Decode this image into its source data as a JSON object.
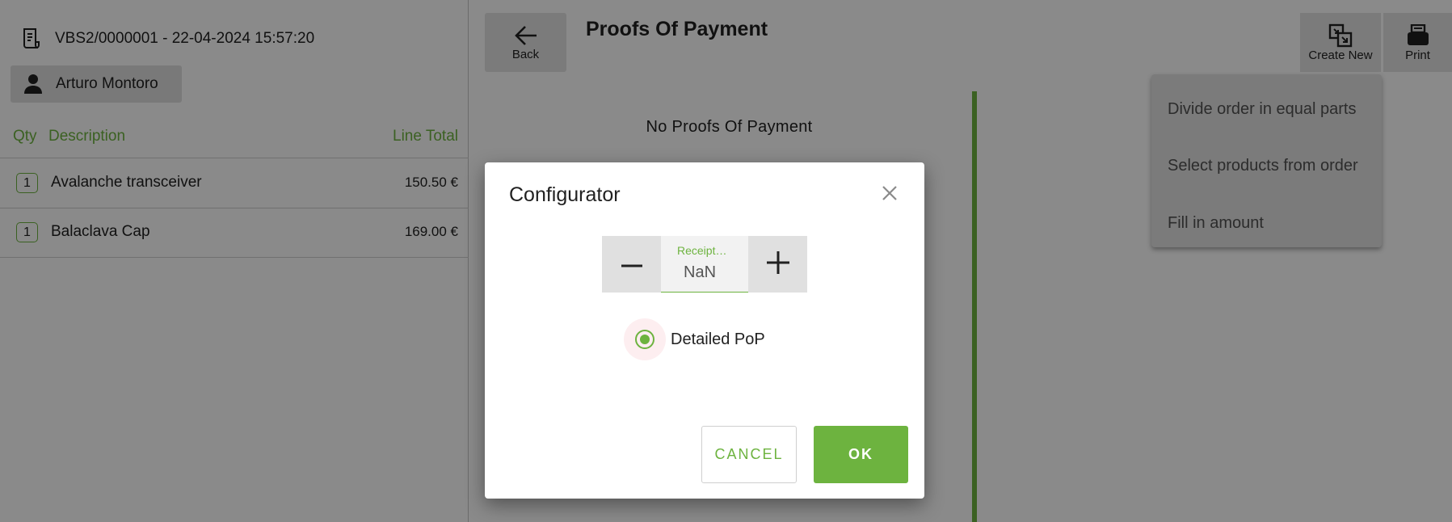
{
  "order": {
    "header": "VBS2/0000001 - 22-04-2024 15:57:20",
    "customer": "Arturo Montoro",
    "columns": {
      "qty": "Qty",
      "description": "Description",
      "line_total": "Line Total"
    },
    "lines": [
      {
        "qty": "1",
        "description": "Avalanche transceiver",
        "total": "150.50 €"
      },
      {
        "qty": "1",
        "description": "Balaclava Cap",
        "total": "169.00 €"
      }
    ]
  },
  "toolbar": {
    "back_label": "Back",
    "page_title": "Proofs Of Payment",
    "create_new_label": "Create New",
    "print_label": "Print"
  },
  "pop": {
    "empty_message": "No Proofs Of Payment"
  },
  "create_menu": {
    "items": [
      "Divide order in equal parts",
      "Select products from order",
      "Fill in amount"
    ]
  },
  "dialog": {
    "title": "Configurator",
    "stepper_label": "Receipt…",
    "stepper_value": "NaN",
    "radio_label": "Detailed PoP",
    "radio_selected": true,
    "cancel_label": "CANCEL",
    "ok_label": "OK"
  },
  "colors": {
    "accent": "#6db33f",
    "overlay": "rgba(0,0,0,0.46)"
  },
  "icons": [
    "receipt-icon",
    "person-icon",
    "arrow-left-icon",
    "create-new-icon",
    "print-icon",
    "close-icon",
    "minus-icon",
    "plus-icon"
  ]
}
